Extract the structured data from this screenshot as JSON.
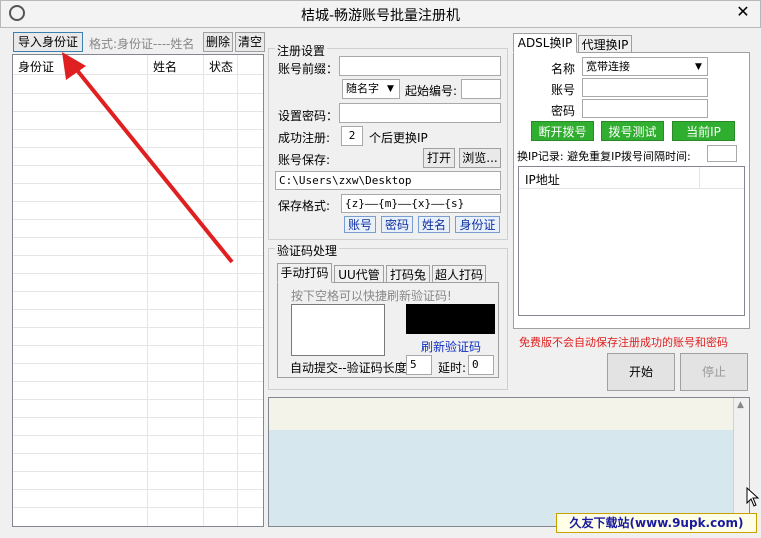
{
  "window": {
    "title": "桔城-畅游账号批量注册机",
    "close": "✕"
  },
  "left": {
    "import_btn": "导入身份证",
    "format_hint": "格式:身份证----姓名",
    "delete_btn": "删除",
    "clear_btn": "清空",
    "columns": [
      "身份证",
      "姓名",
      "状态"
    ]
  },
  "register": {
    "group_title": "注册设置",
    "prefix_label": "账号前缀：",
    "prefix_value": "",
    "mode_value": "随名字",
    "start_label": "起始编号:",
    "start_value": "",
    "password_label": "设置密码：",
    "password_value": "",
    "success_label": "成功注册:",
    "success_value": "2",
    "change_ip_label": "个后更换IP",
    "save_label": "账号保存:",
    "open_btn": "打开",
    "browse_btn": "浏览...",
    "path_value": "C:\\Users\\zxw\\Desktop",
    "format_label": "保存格式:",
    "format_value": "{z}——{m}——{x}——{s}",
    "fmt_buttons": [
      "账号",
      "密码",
      "姓名",
      "身份证"
    ]
  },
  "captcha": {
    "group_title": "验证码处理",
    "tabs": [
      "手动打码",
      "UU代管",
      "打码兔",
      "超人打码"
    ],
    "hint": "按下空格可以快捷刷新验证码!",
    "refresh_link": "刷新验证码",
    "auto_label": "自动提交--验证码长度",
    "length_value": "5",
    "delay_label": "延时:",
    "delay_value": "0"
  },
  "ip": {
    "tabs": [
      "ADSL换IP",
      "代理换IP"
    ],
    "name_label": "名称",
    "name_value": "宽带连接",
    "account_label": "账号",
    "account_value": "",
    "password_label": "密码",
    "password_value": "",
    "btn_disconnect": "断开拨号",
    "btn_test": "拨号测试",
    "btn_current": "当前IP",
    "record_label": "换IP记录: 避免重复IP拨号间隔时间:",
    "interval_value": "",
    "list_header": "IP地址"
  },
  "notice": "免费版不会自动保存注册成功的账号和密码",
  "actions": {
    "start": "开始",
    "stop": "停止"
  },
  "watermark": "久友下载站(www.9upk.com)",
  "colors": {
    "accent_green": "#2fae2f",
    "notice_red": "#e02020",
    "arrow_red": "#e02020"
  }
}
